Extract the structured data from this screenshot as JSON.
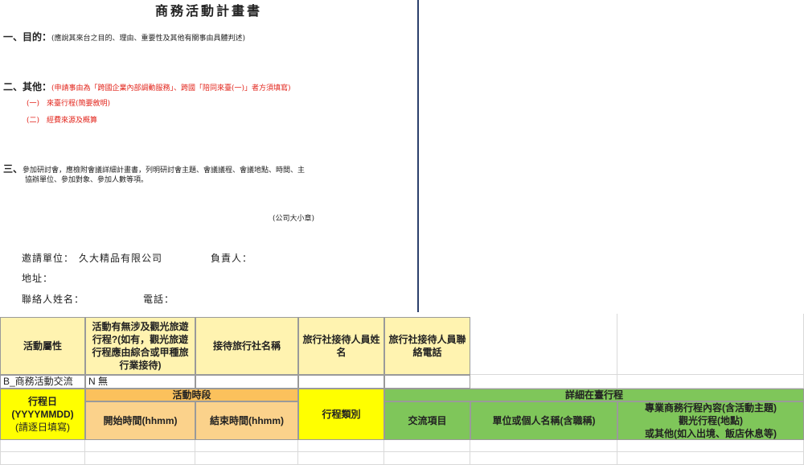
{
  "doc": {
    "title": "商務活動計畫書",
    "s1_label": "一、目的：",
    "s1_note": "(應說其來台之目的、理由、重要性及其他有關事由具體判述)",
    "s2_label": "二、其他：",
    "s2_note": "(申請事由為「跨國企業內部調動服務」、跨國「陪同來臺(一)」者方須填寫)",
    "s2_items": [
      "(一)　來臺行程(簡要敘明)",
      "(二)　經費來源及概算"
    ],
    "s3_label": "三、",
    "s3_line1": "參加研討會，應檢附會議詳細計畫書，列明研討會主題、會議議程、會議地點、時間、主",
    "s3_line2": "協辦單位、參加對象、參加人數等項。",
    "stamp": "(公司大小章)",
    "inviter_label": "邀請單位：",
    "inviter_value": "久大精品有限公司",
    "owner_label": "負責人：",
    "address_label": "地址：",
    "contact_label": "聯絡人姓名：",
    "phone_label": "電話："
  },
  "sheet": {
    "header1": [
      "活動屬性",
      "活動有無涉及觀光旅遊行程?(如有，觀光旅遊行程應由綜合或甲種旅行業接待)",
      "接待旅行社名稱",
      "旅行社接待人員姓名",
      "旅行社接待人員聯絡電話"
    ],
    "row1": [
      "B_商務活動交流",
      "N 無"
    ],
    "itinerary_day": "行程日\n(YYYYMMDD)",
    "itinerary_day_note": "(請逐日填寫)",
    "period": "活動時段",
    "start_time": "開始時間(hhmm)",
    "end_time": "結束時間(hhmm)",
    "trip_type": "行程類別",
    "detail": "詳細在臺行程",
    "exchange_item": "交流項目",
    "unit_name": "單位或個人名稱(含職稱)",
    "content_line1": "專業商務行程內容(含活動主題)",
    "content_line2": "觀光行程(地點)",
    "content_line3": "或其他(如入出境、飯店休息等)"
  }
}
